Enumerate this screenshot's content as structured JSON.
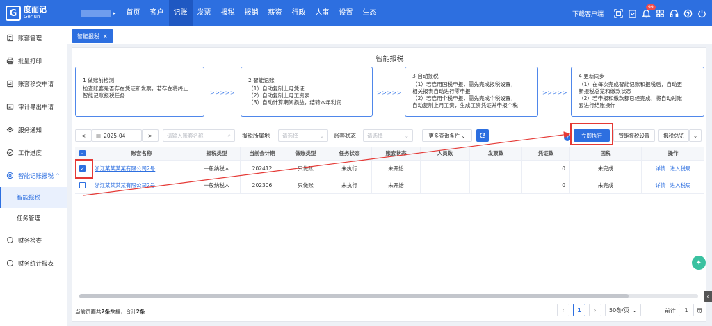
{
  "brand": {
    "logo_mark": "G",
    "name_cn": "度而记",
    "name_en": "Gerlun"
  },
  "nav": {
    "items": [
      "首页",
      "客户",
      "记账",
      "发票",
      "报税",
      "报销",
      "薪资",
      "行政",
      "人事",
      "设置",
      "生态"
    ],
    "active_index": 2
  },
  "topright": {
    "download": "下载客户端",
    "notification_count": "99"
  },
  "sidebar": {
    "items": [
      {
        "label": "账套管理",
        "icon": "ledger-icon"
      },
      {
        "label": "批量打印",
        "icon": "printer-icon"
      },
      {
        "label": "账套移交申请",
        "icon": "transfer-icon"
      },
      {
        "label": "审计导出申请",
        "icon": "audit-icon"
      },
      {
        "label": "服务通知",
        "icon": "notice-icon"
      },
      {
        "label": "工作进度",
        "icon": "progress-icon"
      },
      {
        "label": "智能记账报税",
        "icon": "smart-icon",
        "caret": "^"
      }
    ],
    "sub_items": [
      "智能报税",
      "任务管理"
    ],
    "bottom_items": [
      {
        "label": "财务检查",
        "icon": "check-icon"
      },
      {
        "label": "财务统计报表",
        "icon": "report-icon"
      }
    ]
  },
  "tab": {
    "label": "智能报税",
    "close": "✕"
  },
  "page": {
    "title": "智能报税"
  },
  "steps": [
    {
      "title": "1 做账前检测",
      "lines": [
        "检查账套是否存在凭证和发票，若存在将终止",
        "智能记账报税任务"
      ]
    },
    {
      "title": "2 智能记账",
      "lines": [
        "（1）自动复制上月凭证",
        "（2）自动复制上月工资表",
        "（3）自动计算期间损益，结转本年利润"
      ]
    },
    {
      "title": "3 自动报税",
      "lines": [
        "（1）若启用国税申报，需先完成报税设置，",
        "相关报表自动进行零申报",
        "（2）若启用个税申报，需先完成个税设置，",
        "自动复制上月工资，生成工资凭证并申报个税"
      ]
    },
    {
      "title": "4 更新同步",
      "lines": [
        "（1）在每次完成智能记账和报税后，自动更",
        "新报税总览和缴款状态",
        "（2）若申报和缴款都已经完成，将自动对账",
        "套进行结账操作"
      ]
    }
  ],
  "step_arrow": ">>>>>",
  "filters": {
    "prev": "<",
    "next": ">",
    "period": "2025-04",
    "search_placeholder": "请输入账套名称",
    "region_label": "报税所属地",
    "region_placeholder": "请选择",
    "status_label": "账套状态",
    "status_placeholder": "请选择",
    "more": "更多查询条件",
    "run": "立即执行",
    "settings": "智能报税设置",
    "overview": "报税总览",
    "help": "?"
  },
  "table": {
    "columns": [
      "账套名称",
      "报税类型",
      "当前会计期",
      "做账类型",
      "任务状态",
      "账套状态",
      "人员数",
      "发票数",
      "凭证数",
      "国税",
      "操作"
    ],
    "rows": [
      {
        "checked": true,
        "name": "浙江某某某某有限公司2号",
        "tax_type": "一般纳税人",
        "period": "202412",
        "mode": "只做账",
        "task": "未执行",
        "acct_status": "未开始",
        "people": "",
        "invoices": "",
        "vouchers": "0",
        "national_tax": "未完成",
        "ops": [
          "详情",
          "进入税局"
        ]
      },
      {
        "checked": false,
        "name": "浙江某某某某有限公司2号",
        "tax_type": "一般纳税人",
        "period": "202306",
        "mode": "只做账",
        "task": "未执行",
        "acct_status": "未开始",
        "people": "",
        "invoices": "",
        "vouchers": "0",
        "national_tax": "未完成",
        "ops": [
          "详情",
          "进入税局"
        ]
      }
    ]
  },
  "footer": {
    "info_prefix": "当前页面共",
    "info_count": "2条",
    "info_mid": "数据，合计",
    "info_total": "2条",
    "page": "1",
    "page_size": "50条/页",
    "goto_label": "前往",
    "goto_value": "1",
    "goto_suffix": "页"
  }
}
